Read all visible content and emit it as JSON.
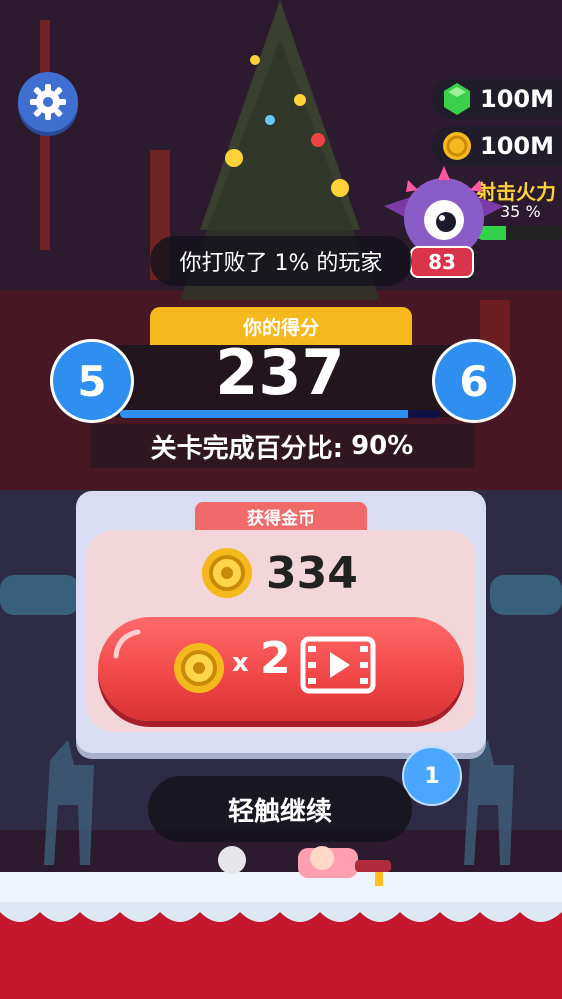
{
  "resources": {
    "gems": "100M",
    "coins": "100M"
  },
  "boss": {
    "level": "83",
    "firepower_label": "射击火力",
    "firepower_percent": "35 %",
    "firepower_fill": 0.35
  },
  "result": {
    "beat_text": "你打败了 1% 的玩家",
    "score_header": "你的得分",
    "score": "237",
    "current_level": "5",
    "next_level": "6",
    "level_progress": 0.9,
    "completion_label": "关卡完成百分比:",
    "completion_value": "90%"
  },
  "reward": {
    "title": "获得金币",
    "coins": "334",
    "double_x": "x",
    "double_multiplier": "2"
  },
  "continue_label": "轻触继续",
  "floating_bubble": "1",
  "colors": {
    "accent_blue": "#2f8ff0",
    "score_yellow": "#f5b91e",
    "reward_red": "#f24848",
    "gem_green": "#33d04a"
  },
  "icons": [
    "gear-icon",
    "gem-icon",
    "coin-icon",
    "video-icon",
    "boss-monster-icon",
    "player-character-icon"
  ]
}
